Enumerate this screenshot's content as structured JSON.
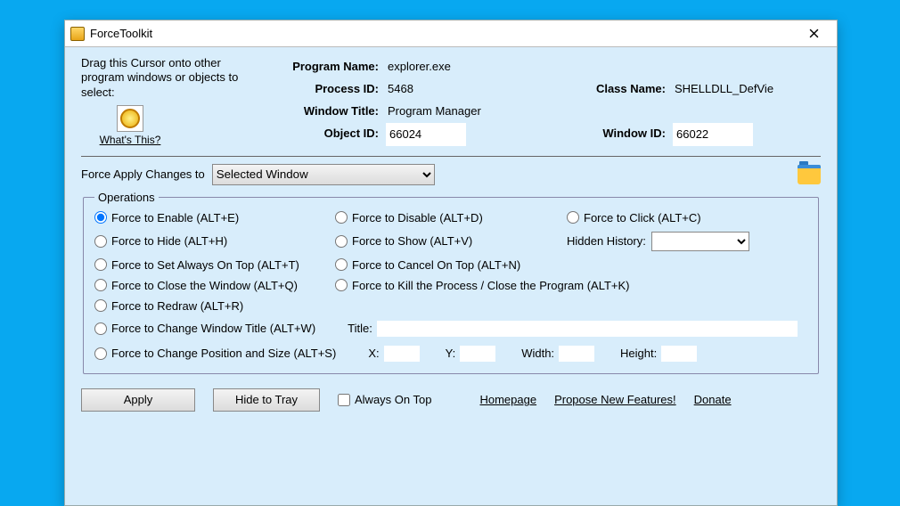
{
  "window": {
    "title": "ForceToolkit"
  },
  "dragPrompt": "Drag this Cursor onto other program windows or objects to select:",
  "whatsThis": "What's This?",
  "info": {
    "programNameLabel": "Program Name:",
    "programName": "explorer.exe",
    "processIdLabel": "Process ID:",
    "processId": "5468",
    "classNameLabel": "Class Name:",
    "className": "SHELLDLL_DefVie",
    "windowTitleLabel": "Window Title:",
    "windowTitle": "Program Manager",
    "objectIdLabel": "Object ID:",
    "objectId": "66024",
    "windowIdLabel": "Window ID:",
    "windowId": "66022"
  },
  "forceApply": {
    "label": "Force Apply Changes to",
    "value": "Selected Window"
  },
  "operations": {
    "legend": "Operations",
    "enable": "Force to Enable (ALT+E)",
    "disable": "Force to Disable (ALT+D)",
    "click": "Force to Click (ALT+C)",
    "hide": "Force to Hide (ALT+H)",
    "show": "Force to Show (ALT+V)",
    "hiddenHistoryLabel": "Hidden History:",
    "alwaysOnTop": "Force to Set Always On Top (ALT+T)",
    "cancelOnTop": "Force to Cancel On Top (ALT+N)",
    "closeWindow": "Force to Close the Window (ALT+Q)",
    "killProcess": "Force to Kill the Process / Close the Program (ALT+K)",
    "redraw": "Force to Redraw (ALT+R)",
    "changeTitle": "Force to Change Window Title (ALT+W)",
    "titleLabel": "Title:",
    "titleValue": "",
    "changePos": "Force to Change Position and Size (ALT+S)",
    "xLabel": "X:",
    "yLabel": "Y:",
    "widthLabel": "Width:",
    "heightLabel": "Height:",
    "x": "",
    "y": "",
    "width": "",
    "height": ""
  },
  "footer": {
    "apply": "Apply",
    "hideToTray": "Hide to Tray",
    "alwaysOnTop": "Always On Top",
    "homepage": "Homepage",
    "propose": "Propose New Features!",
    "donate": "Donate"
  }
}
